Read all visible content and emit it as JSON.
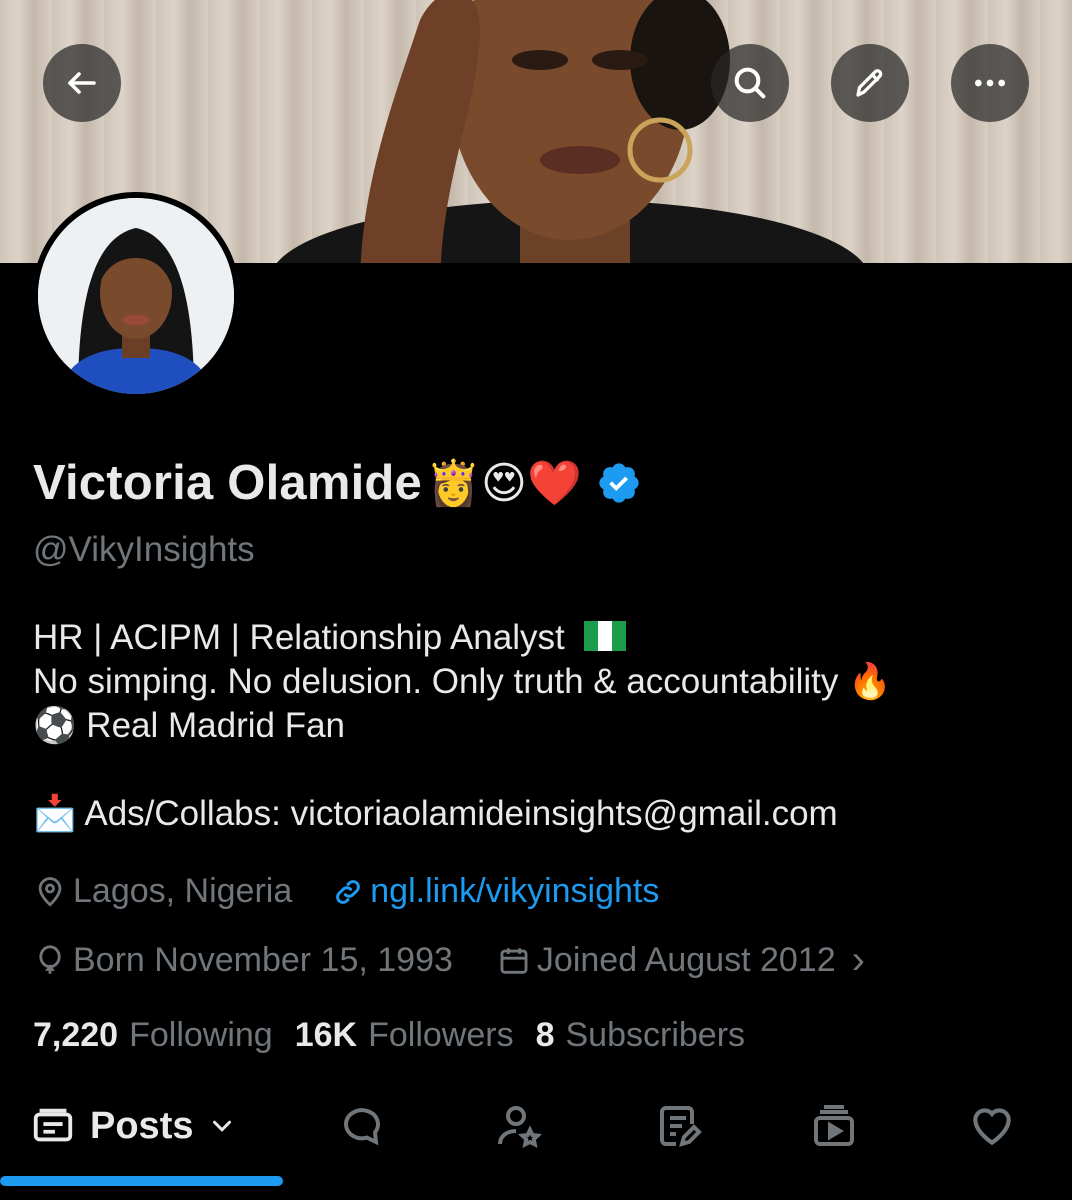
{
  "header": {
    "back_icon": "arrow-left-icon",
    "search_icon": "search-icon",
    "edit_icon": "pencil-icon",
    "more_icon": "more-horizontal-icon"
  },
  "profile": {
    "name": "Victoria Olamide",
    "name_emojis": "👸😍❤️",
    "verified_icon": "verified-badge-icon",
    "handle": "@VikyInsights"
  },
  "bio": {
    "line1": "HR | ACIPM | Relationship Analyst",
    "line1_flag": "nigeria-flag-icon",
    "line2": "No simping. No delusion. Only truth & accountability 🔥",
    "line3": "⚽ Real Madrid Fan",
    "line4": "📩 Ads/Collabs: victoriaolamideinsights@gmail.com"
  },
  "meta": {
    "location": "Lagos, Nigeria",
    "website": "ngl.link/vikyinsights",
    "born": "Born November 15, 1993",
    "joined": "Joined August 2012",
    "joined_chevron": "›"
  },
  "stats": {
    "following_count": "7,220",
    "following_label": "Following",
    "followers_count": "16K",
    "followers_label": "Followers",
    "subscribers_count": "8",
    "subscribers_label": "Subscribers"
  },
  "tabs": {
    "posts_label": "Posts",
    "icons": [
      "posts-icon",
      "replies-icon",
      "subs-icon",
      "articles-icon",
      "media-icon",
      "likes-icon"
    ]
  },
  "colors": {
    "accent": "#1d9bf0",
    "text_primary": "#e7e9ea",
    "text_secondary": "#71767b",
    "background": "#000000"
  }
}
